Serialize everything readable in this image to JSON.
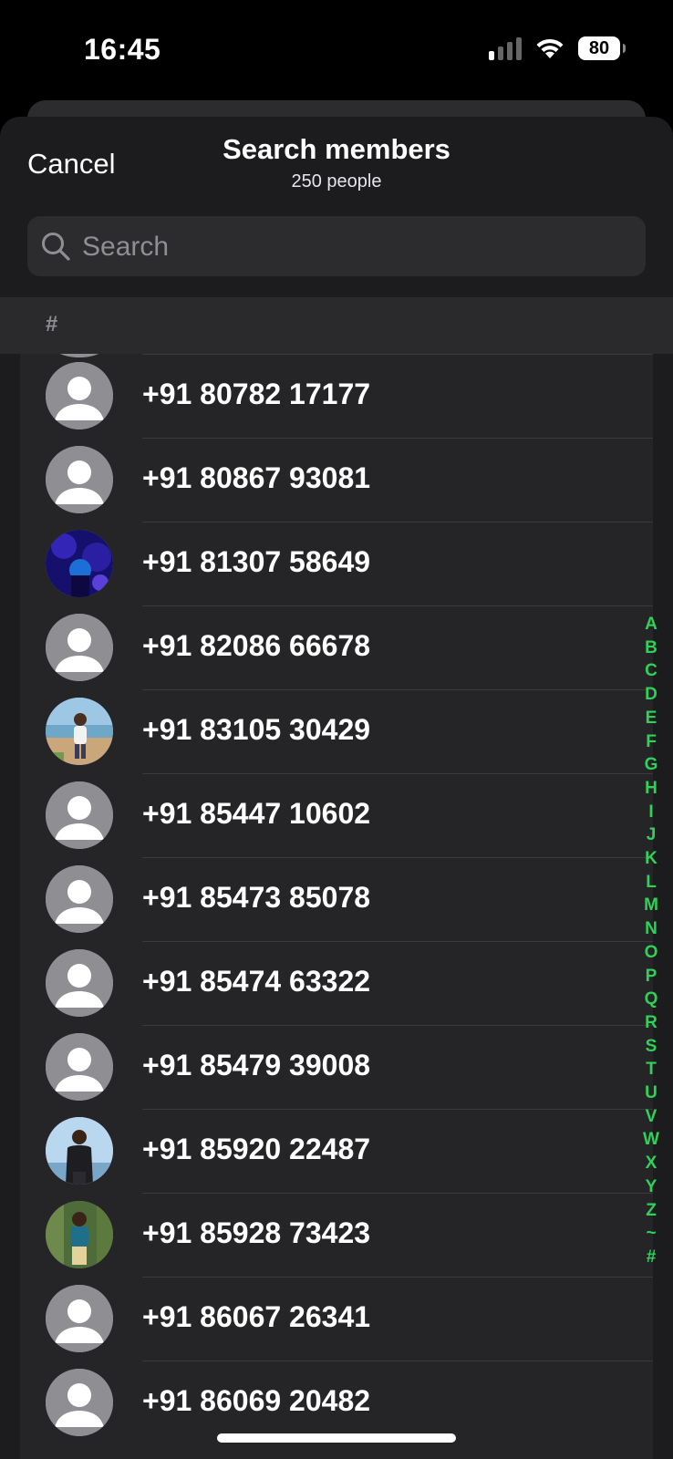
{
  "status_bar": {
    "time": "16:45",
    "battery": "80"
  },
  "header": {
    "cancel_label": "Cancel",
    "title": "Search members",
    "subtitle": "250 people"
  },
  "search": {
    "placeholder": "Search"
  },
  "section": {
    "label": "#"
  },
  "members": [
    {
      "phone": "+91 80782 17177",
      "avatar": "default"
    },
    {
      "phone": "+91 80867 93081",
      "avatar": "default"
    },
    {
      "phone": "+91 81307 58649",
      "avatar": "photo-blue"
    },
    {
      "phone": "+91 82086 66678",
      "avatar": "default"
    },
    {
      "phone": "+91 83105 30429",
      "avatar": "photo-beach"
    },
    {
      "phone": "+91 85447 10602",
      "avatar": "default"
    },
    {
      "phone": "+91 85473 85078",
      "avatar": "default"
    },
    {
      "phone": "+91 85474 63322",
      "avatar": "default"
    },
    {
      "phone": "+91 85479 39008",
      "avatar": "default"
    },
    {
      "phone": "+91 85920 22487",
      "avatar": "photo-sky"
    },
    {
      "phone": "+91 85928 73423",
      "avatar": "photo-green"
    },
    {
      "phone": "+91 86067 26341",
      "avatar": "default"
    },
    {
      "phone": "+91 86069 20482",
      "avatar": "default"
    }
  ],
  "index_letters": [
    "A",
    "B",
    "C",
    "D",
    "E",
    "F",
    "G",
    "H",
    "I",
    "J",
    "K",
    "L",
    "M",
    "N",
    "O",
    "P",
    "Q",
    "R",
    "S",
    "T",
    "U",
    "V",
    "W",
    "X",
    "Y",
    "Z",
    "~",
    "#"
  ],
  "colors": {
    "accent": "#30d158",
    "sheet_background": "#1c1c1e",
    "row_background": "#252527"
  }
}
